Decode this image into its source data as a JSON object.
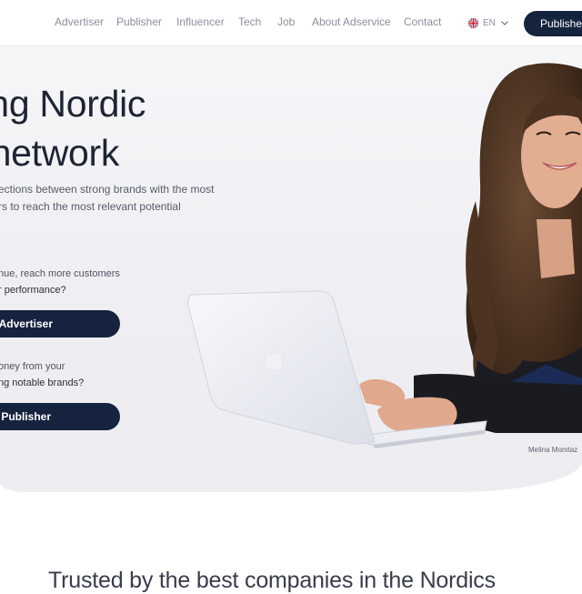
{
  "nav": {
    "links": [
      "Advertiser",
      "Publisher",
      "Influencer",
      "Tech",
      "Job",
      "About Adservice",
      "Contact"
    ],
    "language": "EN",
    "button": "Publisher"
  },
  "hero": {
    "headline_line1": "ding Nordic",
    "headline_line2": "e network",
    "lead_line1": "ections between strong brands with the most",
    "lead_line2": "rs to reach the most relevant potential",
    "advertiser_q1": "nue, reach more customers",
    "advertiser_q2": "r performance?",
    "advertiser_button": "Advertiser",
    "publisher_q1": "oney from your",
    "publisher_q2": "ng notable brands?",
    "publisher_button": "Publisher",
    "photo_caption": "Melina Momtaz"
  },
  "trusted": {
    "heading": "Trusted by the best companies in the Nordics"
  },
  "colors": {
    "navy": "#16233f",
    "hero_bg": "#efeff3"
  },
  "icons": {
    "flag": "uk-flag-icon",
    "chevron": "chevron-down-icon"
  }
}
